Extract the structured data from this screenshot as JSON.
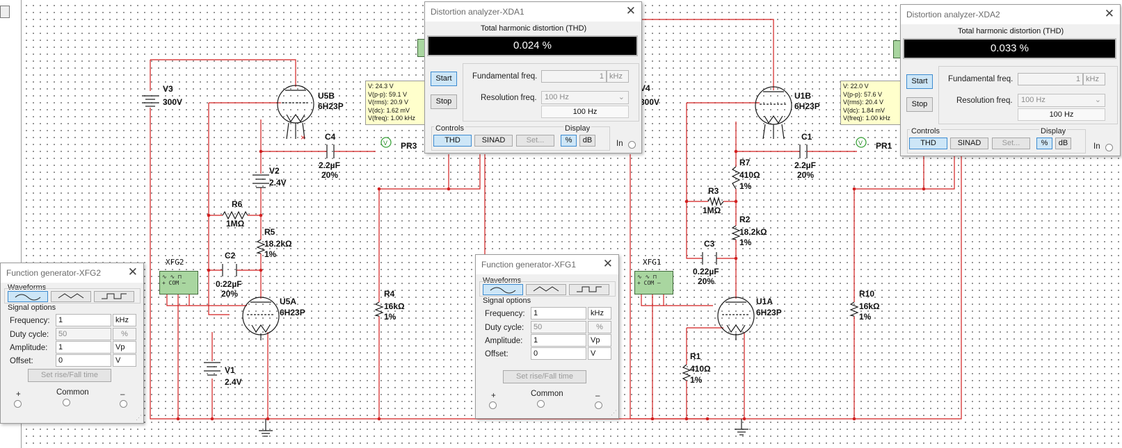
{
  "xda1": {
    "title": "Distortion analyzer-XDA1",
    "thd_heading": "Total harmonic distortion (THD)",
    "reading": "0.024 %",
    "start": "Start",
    "stop": "Stop",
    "fund_label": "Fundamental freq.",
    "fund_value": "1",
    "fund_unit": "kHz",
    "res_label": "Resolution freq.",
    "res_select": "100 Hz",
    "res_value": "100 Hz",
    "controls": "Controls",
    "thd": "THD",
    "sinad": "SINAD",
    "set": "Set...",
    "display": "Display",
    "pct": "%",
    "db": "dB",
    "in": "In"
  },
  "xda2": {
    "title": "Distortion analyzer-XDA2",
    "thd_heading": "Total harmonic distortion (THD)",
    "reading": "0.033 %",
    "start": "Start",
    "stop": "Stop",
    "fund_label": "Fundamental freq.",
    "fund_value": "1",
    "fund_unit": "kHz",
    "res_label": "Resolution freq.",
    "res_select": "100 Hz",
    "res_value": "100 Hz",
    "controls": "Controls",
    "thd": "THD",
    "sinad": "SINAD",
    "set": "Set...",
    "display": "Display",
    "pct": "%",
    "db": "dB",
    "in": "In"
  },
  "xfg1": {
    "title": "Function generator-XFG1",
    "waveforms": "Waveforms",
    "signal_options": "Signal options",
    "frequency_label": "Frequency:",
    "frequency_value": "1",
    "frequency_unit": "kHz",
    "duty_label": "Duty cycle:",
    "duty_value": "50",
    "duty_unit": "%",
    "amplitude_label": "Amplitude:",
    "amplitude_value": "1",
    "amplitude_unit": "Vp",
    "offset_label": "Offset:",
    "offset_value": "0",
    "offset_unit": "V",
    "rise_fall": "Set rise/Fall time",
    "plus": "+",
    "common": "Common",
    "minus": "–"
  },
  "xfg2": {
    "title": "Function generator-XFG2",
    "waveforms": "Waveforms",
    "signal_options": "Signal options",
    "frequency_label": "Frequency:",
    "frequency_value": "1",
    "frequency_unit": "kHz",
    "duty_label": "Duty cycle:",
    "duty_value": "50",
    "duty_unit": "%",
    "amplitude_label": "Amplitude:",
    "amplitude_value": "1",
    "amplitude_unit": "Vp",
    "offset_label": "Offset:",
    "offset_value": "0",
    "offset_unit": "V",
    "rise_fall": "Set rise/Fall time",
    "plus": "+",
    "common": "Common",
    "minus": "–"
  },
  "probe_pr3": {
    "v": "V: 24.3 V",
    "vpp": "V(p-p): 59.1 V",
    "vrms": "V(rms): 20.9 V",
    "vdc": "V(dc): 1.62 mV",
    "vfreq": "V(freq): 1.00 kHz",
    "name": "PR3"
  },
  "probe_pr1": {
    "v": "V: 22.0 V",
    "vpp": "V(p-p): 57.6 V",
    "vrms": "V(rms): 20.4 V",
    "vdc": "V(dc): 1.84 mV",
    "vfreq": "V(freq): 1.00 kHz",
    "name": "PR1"
  },
  "labels": {
    "v3": "V3",
    "v3_val": "300V",
    "v4": "V4",
    "v4_val": "300V",
    "u5b": "U5B",
    "u5b_type": "6H23P",
    "u1b": "U1B",
    "u1b_type": "6H23P",
    "u5a": "U5A",
    "u5a_type": "6H23P",
    "u1a": "U1A",
    "u1a_type": "6H23P",
    "c4": "C4",
    "c4_val": "2.2µF",
    "c4_tol": "20%",
    "c1": "C1",
    "c1_val": "2.2µF",
    "c1_tol": "20%",
    "v2": "V2",
    "v2_val": "2.4V",
    "v1": "V1",
    "v1_val": "2.4V",
    "r6": "R6",
    "r6_val": "1MΩ",
    "r3": "R3",
    "r3_val": "1MΩ",
    "r5": "R5",
    "r5_val": "18.2kΩ",
    "r5_tol": "1%",
    "r2": "R2",
    "r2_val": "18.2kΩ",
    "r2_tol": "1%",
    "r7": "R7",
    "r7_val": "410Ω",
    "r7_tol": "1%",
    "r1": "R1",
    "r1_val": "410Ω",
    "r1_tol": "1%",
    "c2": "C2",
    "c2_val": "0.22µF",
    "c2_tol": "20%",
    "c3": "C3",
    "c3_val": "0.22µF",
    "c3_tol": "20%",
    "r4": "R4",
    "r4_val": "16kΩ",
    "r4_tol": "1%",
    "r10": "R10",
    "r10_val": "16kΩ",
    "r10_tol": "1%",
    "xfg2": "XFG2",
    "xfg1": "XFG1",
    "com": "COM"
  },
  "colors": {
    "wire": "#d21f1f",
    "probe_bg": "#ffffcc",
    "instrument_green": "#a9d6a0",
    "thd_display_bg": "#000000",
    "selected_button": "#cde6f7"
  }
}
